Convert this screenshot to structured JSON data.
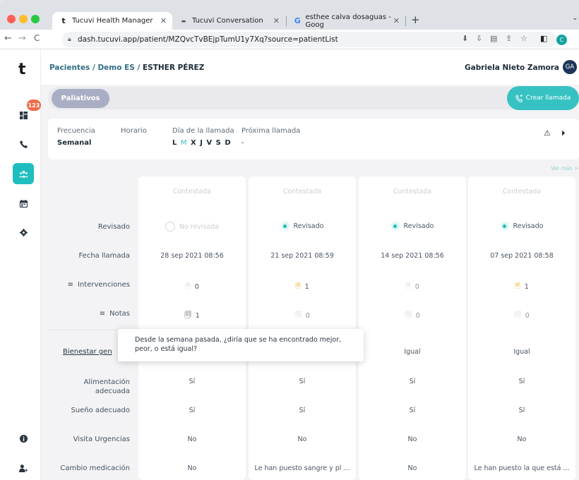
{
  "browser": {
    "tabs": [
      {
        "favicon": "t",
        "title": "Tucuvi Health Manager"
      },
      {
        "favicon": "▬",
        "title": "Tucuvi Conversation"
      },
      {
        "favicon": "G",
        "title": "esthee calva dosaguas - Goog"
      }
    ],
    "url": "dash.tucuvi.app/patient/MZQvcTvBEjpTumU1y7Xq?source=patientList",
    "profile_initial": "C"
  },
  "sidebar": {
    "brand": "t",
    "badge_count": "123",
    "items": [
      {
        "icon": "dashboard-icon"
      },
      {
        "icon": "phone-icon"
      },
      {
        "icon": "patients-icon"
      },
      {
        "icon": "calendar-icon"
      },
      {
        "icon": "settings-icon"
      },
      {
        "icon": "info-icon"
      },
      {
        "icon": "user-add-icon"
      }
    ]
  },
  "header": {
    "breadcrumb_prefix": "Pacientes / Demo ES / ",
    "breadcrumb_current": "ESTHER PÉREZ",
    "user_name": "Gabriela Nieto Zamora",
    "user_initials": "GA"
  },
  "program": {
    "pill": "Paliativos",
    "call_button": "Crear llamada"
  },
  "info": {
    "frecuencia_label": "Frecuencia",
    "frecuencia_value": "Semanal",
    "horario_label": "Horario",
    "dia_label": "Día de la llamada",
    "days": [
      "L",
      "M",
      "X",
      "J",
      "V",
      "S",
      "D"
    ],
    "proxima_label": "Próxima llamada",
    "proxima_value": "-"
  },
  "ver_mas": "Ver más >",
  "row_labels": {
    "revisado": "Revisado",
    "fecha": "Fecha llamada",
    "intervenciones": "Intervenciones",
    "notas": "Notas",
    "bienestar": "Bienestar gen",
    "alimentacion_1": "Alimentación",
    "alimentacion_2": "adecuada",
    "sueno": "Sueño adecuado",
    "urgencias": "Visita Urgencias",
    "medicacion": "Cambio medicación"
  },
  "calls": [
    {
      "status": "Contestada",
      "revisado": "No revisada",
      "fecha": "28 sep 2021 08:56",
      "intervenciones": "0",
      "notas": "1",
      "bienestar": "",
      "alimentacion": "Sí",
      "sueno": "Sí",
      "urgencias": "No",
      "medicacion": "No"
    },
    {
      "status": "Contestada",
      "revisado": "Revisado",
      "fecha": "21 sep 2021 08:59",
      "intervenciones": "1",
      "notas": "0",
      "bienestar": "",
      "alimentacion": "Sí",
      "sueno": "Sí",
      "urgencias": "No",
      "medicacion": "Le han puesto sangre y pl ..."
    },
    {
      "status": "Contestada",
      "revisado": "Revisado",
      "fecha": "14 sep 2021 08:56",
      "intervenciones": "0",
      "notas": "0",
      "bienestar": "Igual",
      "alimentacion": "Sí",
      "sueno": "Sí",
      "urgencias": "No",
      "medicacion": "No"
    },
    {
      "status": "Contestada",
      "revisado": "Revisado",
      "fecha": "07 sep 2021 08:58",
      "intervenciones": "1",
      "notas": "0",
      "bienestar": "Igual",
      "alimentacion": "Sí",
      "sueno": "Sí",
      "urgencias": "No",
      "medicacion": "Le han puesto la que está ..."
    }
  ],
  "tooltip": "Desde la semana pasada, ¿diría que se ha encontrado mejor, peor, o está igual?",
  "colors": {
    "accent": "#1fbdbd",
    "link": "#2f6f85",
    "alert": "#ee6b4d"
  }
}
